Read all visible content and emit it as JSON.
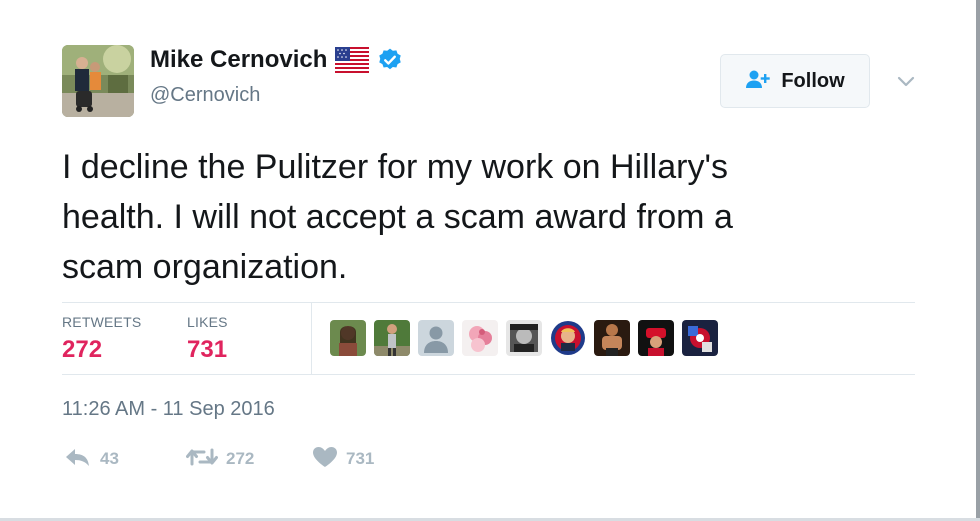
{
  "header": {
    "display_name": "Mike Cernovich",
    "handle": "@Cernovich",
    "follow_label": "Follow"
  },
  "icons": {
    "flag": "us-flag-emoji",
    "verified": "verified-badge-icon",
    "follow": "add-user-icon",
    "caret": "chevron-down-icon",
    "reply": "reply-icon",
    "retweet": "retweet-icon",
    "like": "heart-icon"
  },
  "tweet": {
    "lines": [
      "I decline the Pulitzer for my work on Hillary's",
      "health. I will not accept a scam award from a",
      "scam organization."
    ]
  },
  "stats": {
    "retweets_label": "RETWEETS",
    "retweets_value": "272",
    "likes_label": "LIKES",
    "likes_value": "731"
  },
  "timestamp": "11:26 AM - 11 Sep 2016",
  "actions": {
    "reply_count": "43",
    "retweet_count": "272",
    "like_count": "731"
  },
  "colors": {
    "stat_value": "#e0245e",
    "verified": "#1da1f2",
    "secondary_text": "#657786",
    "action_gray": "#aab8c2"
  }
}
